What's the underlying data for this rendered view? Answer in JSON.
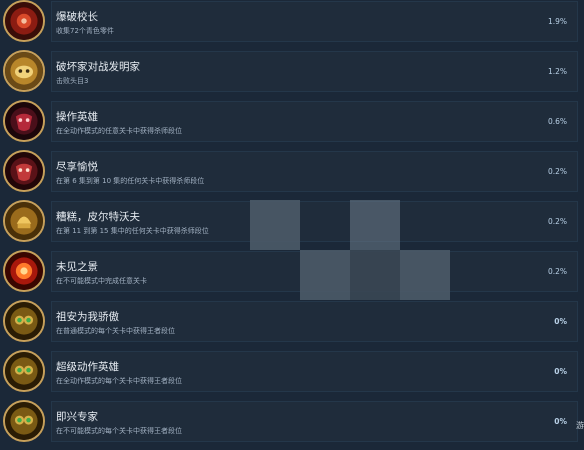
{
  "achievements": [
    {
      "title": "爆破校长",
      "desc": "收集72个青色零件",
      "pct": "1.9%",
      "icon": "red-gear-medallion-icon",
      "colors": [
        "#8b1c12",
        "#d94a2a",
        "#3a0d08"
      ]
    },
    {
      "title": "破坏家对战发明家",
      "desc": "击败头目3",
      "pct": "1.2%",
      "icon": "gold-helmet-medallion-icon",
      "colors": [
        "#b8862a",
        "#f1d27a",
        "#6b4a16"
      ]
    },
    {
      "title": "操作英雄",
      "desc": "在全动作模式的任意关卡中获得杀师段位",
      "pct": "0.6%",
      "icon": "dark-red-mask-medallion-icon",
      "colors": [
        "#4a0f1a",
        "#b52a3a",
        "#1c060a"
      ]
    },
    {
      "title": "尽享愉悦",
      "desc": "在第 6 集到第 10 集的任何关卡中获得杀师段位",
      "pct": "0.2%",
      "icon": "crimson-mask-medallion-icon",
      "colors": [
        "#5a1218",
        "#c23a3a",
        "#220608"
      ]
    },
    {
      "title": "糟糕，皮尔特沃夫",
      "desc": "在第 11 到第 15 集中的任何关卡中获得杀师段位",
      "pct": "0.2%",
      "icon": "golden-helmet-medallion-icon",
      "colors": [
        "#9a6b1c",
        "#f0c760",
        "#4a3008"
      ]
    },
    {
      "title": "未见之景",
      "desc": "在不可能模式中完成任意关卡",
      "pct": "0.2%",
      "icon": "flaming-gear-medallion-icon",
      "colors": [
        "#a8180c",
        "#ff7a2a",
        "#3a0600"
      ]
    },
    {
      "title": "祖安为我骄傲",
      "desc": "在普通模式的每个关卡中获得王者段位",
      "pct": "0%",
      "icon": "green-goggles-medallion-icon",
      "colors": [
        "#7a5a14",
        "#d6b24a",
        "#2a1c04"
      ]
    },
    {
      "title": "超级动作英雄",
      "desc": "在全动作模式的每个关卡中获得王者段位",
      "pct": "0%",
      "icon": "green-goggles-medallion-icon",
      "colors": [
        "#7a5a14",
        "#d6b24a",
        "#2a1c04"
      ]
    },
    {
      "title": "即兴专家",
      "desc": "在不可能模式的每个关卡中获得王者段位",
      "pct": "0%",
      "icon": "green-goggles-medallion-icon",
      "colors": [
        "#7a5a14",
        "#d6b24a",
        "#2a1c04"
      ]
    }
  ],
  "corner_text": "游"
}
